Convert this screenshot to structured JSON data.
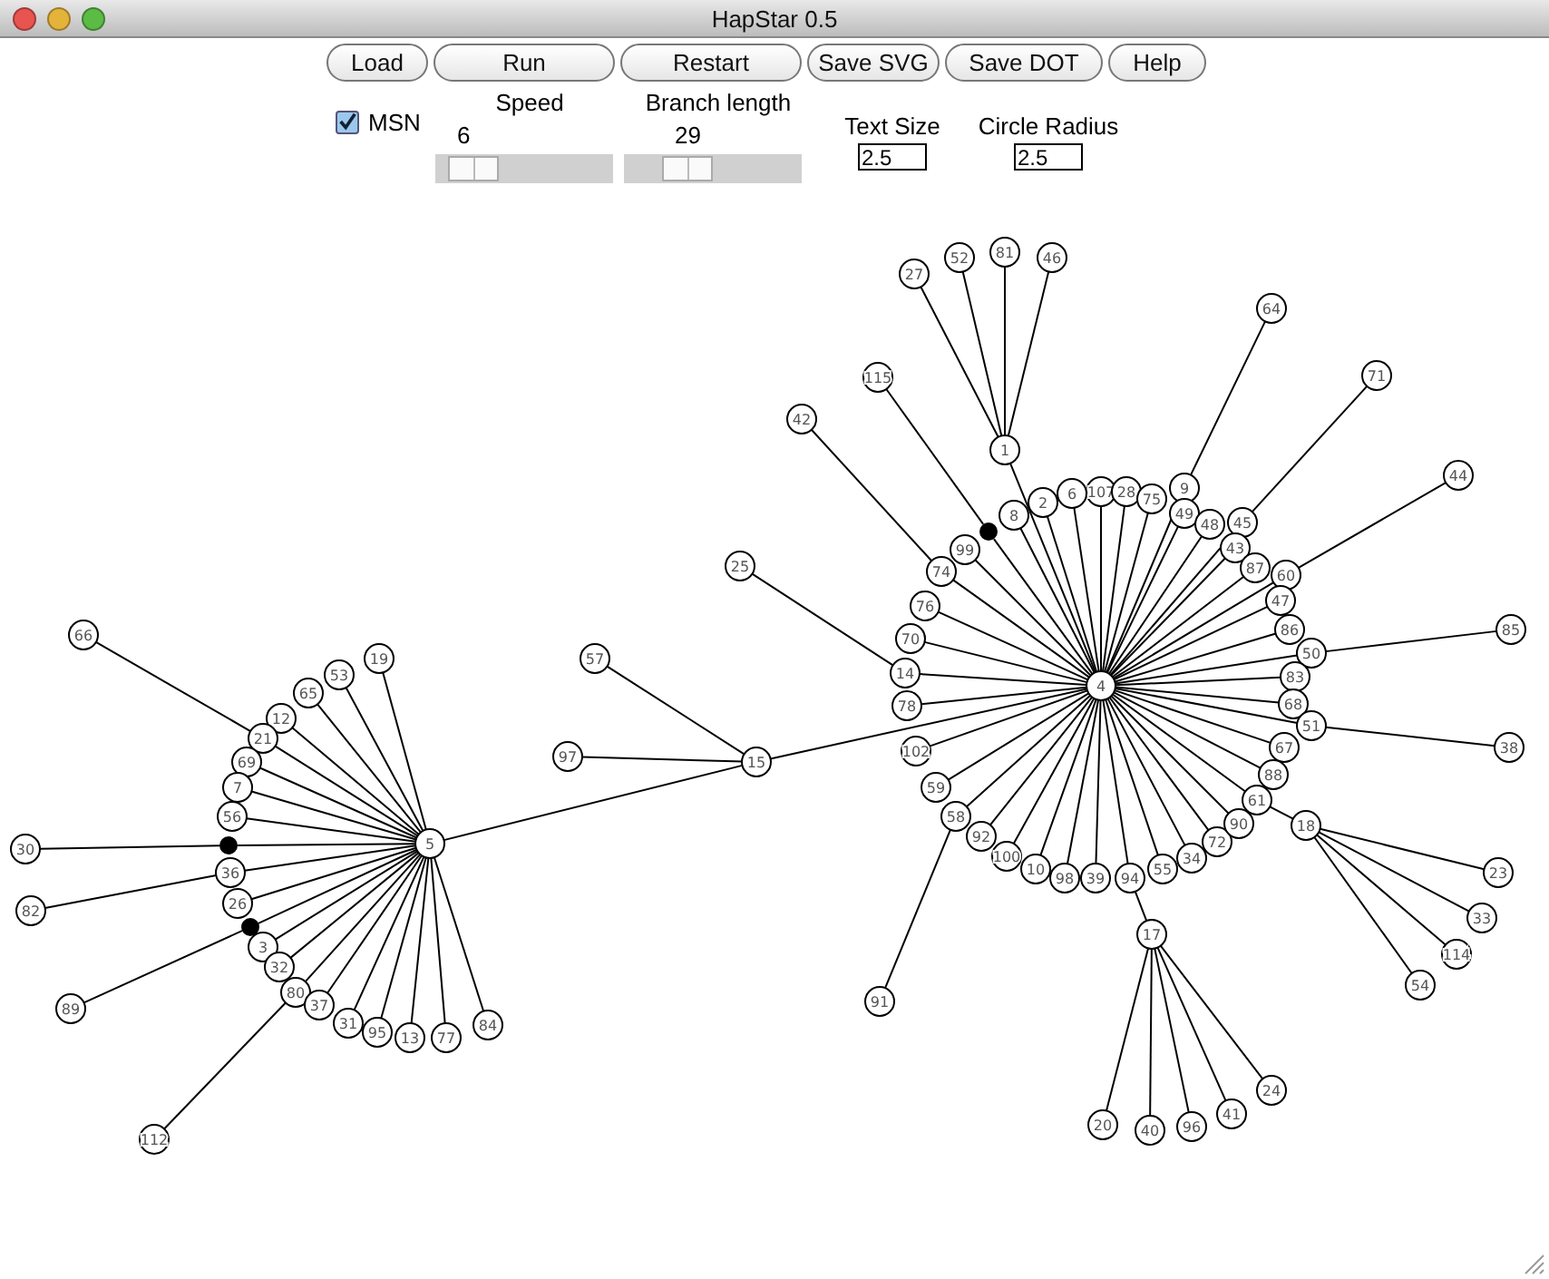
{
  "window": {
    "title": "HapStar 0.5"
  },
  "toolbar": {
    "buttons": [
      "Load",
      "Run",
      "Restart",
      "Save SVG",
      "Save DOT",
      "Help"
    ]
  },
  "controls": {
    "msn": {
      "label": "MSN",
      "checked": true
    },
    "sliders": [
      {
        "label": "Speed",
        "reading": "6",
        "level": 0.1
      },
      {
        "label": "Branch length",
        "reading": "29",
        "level": 0.3
      }
    ],
    "fields": [
      {
        "label": "Text Size",
        "value": "2.5"
      },
      {
        "label": "Circle Radius",
        "value": "2.5"
      }
    ]
  },
  "network": {
    "root": {
      "kind": "haplotype",
      "label": "4",
      "children": [
        {
          "kind": "haplotype",
          "label": "1",
          "children": [
            {
              "kind": "haplotype",
              "label": "27"
            },
            {
              "kind": "haplotype",
              "label": "52"
            },
            {
              "kind": "haplotype",
              "label": "81"
            },
            {
              "kind": "haplotype",
              "label": "46"
            }
          ]
        },
        {
          "kind": "haplotype",
          "label": "8"
        },
        {
          "kind": "haplotype",
          "label": "2"
        },
        {
          "kind": "haplotype",
          "label": "6"
        },
        {
          "kind": "haplotype",
          "label": "107"
        },
        {
          "kind": "haplotype",
          "label": "28"
        },
        {
          "kind": "haplotype",
          "label": "75"
        },
        {
          "kind": "haplotype",
          "label": "9",
          "children": [
            {
              "kind": "haplotype",
              "label": "64"
            }
          ]
        },
        {
          "kind": "haplotype",
          "label": "49"
        },
        {
          "kind": "haplotype",
          "label": "48"
        },
        {
          "kind": "haplotype",
          "label": "45",
          "children": [
            {
              "kind": "haplotype",
              "label": "71"
            }
          ]
        },
        {
          "kind": "haplotype",
          "label": "43"
        },
        {
          "kind": "haplotype",
          "label": "87"
        },
        {
          "kind": "haplotype",
          "label": "60",
          "children": [
            {
              "kind": "haplotype",
              "label": "44"
            }
          ]
        },
        {
          "kind": "haplotype",
          "label": "47"
        },
        {
          "kind": "haplotype",
          "label": "86"
        },
        {
          "kind": "haplotype",
          "label": "50",
          "children": [
            {
              "kind": "haplotype",
              "label": "85"
            }
          ]
        },
        {
          "kind": "haplotype",
          "label": "83"
        },
        {
          "kind": "haplotype",
          "label": "68"
        },
        {
          "kind": "haplotype",
          "label": "67"
        },
        {
          "kind": "haplotype",
          "label": "51",
          "children": [
            {
              "kind": "haplotype",
              "label": "38"
            }
          ]
        },
        {
          "kind": "haplotype",
          "label": "88"
        },
        {
          "kind": "haplotype",
          "label": "61",
          "children": [
            {
              "kind": "haplotype",
              "label": "18",
              "children": [
                {
                  "kind": "haplotype",
                  "label": "23"
                },
                {
                  "kind": "haplotype",
                  "label": "33"
                },
                {
                  "kind": "haplotype",
                  "label": "114"
                },
                {
                  "kind": "haplotype",
                  "label": "54"
                }
              ]
            }
          ]
        },
        {
          "kind": "haplotype",
          "label": "58",
          "children": [
            {
              "kind": "haplotype",
              "label": "91"
            }
          ]
        },
        {
          "kind": "haplotype",
          "label": "92"
        },
        {
          "kind": "haplotype",
          "label": "100"
        },
        {
          "kind": "haplotype",
          "label": "10"
        },
        {
          "kind": "haplotype",
          "label": "98"
        },
        {
          "kind": "haplotype",
          "label": "39"
        },
        {
          "kind": "haplotype",
          "label": "94",
          "children": [
            {
              "kind": "haplotype",
              "label": "17",
              "children": [
                {
                  "kind": "haplotype",
                  "label": "20"
                },
                {
                  "kind": "haplotype",
                  "label": "40"
                },
                {
                  "kind": "haplotype",
                  "label": "96"
                },
                {
                  "kind": "haplotype",
                  "label": "41"
                },
                {
                  "kind": "haplotype",
                  "label": "24"
                }
              ]
            }
          ]
        },
        {
          "kind": "haplotype",
          "label": "55"
        },
        {
          "kind": "haplotype",
          "label": "34"
        },
        {
          "kind": "haplotype",
          "label": "72"
        },
        {
          "kind": "haplotype",
          "label": "90"
        },
        {
          "kind": "median",
          "children": [
            {
              "kind": "haplotype",
              "label": "115"
            }
          ]
        },
        {
          "kind": "haplotype",
          "label": "99"
        },
        {
          "kind": "haplotype",
          "label": "74",
          "children": [
            {
              "kind": "haplotype",
              "label": "42"
            }
          ]
        },
        {
          "kind": "haplotype",
          "label": "76"
        },
        {
          "kind": "haplotype",
          "label": "70"
        },
        {
          "kind": "haplotype",
          "label": "14",
          "children": [
            {
              "kind": "haplotype",
              "label": "25"
            }
          ]
        },
        {
          "kind": "haplotype",
          "label": "78"
        },
        {
          "kind": "haplotype",
          "label": "102"
        },
        {
          "kind": "haplotype",
          "label": "59"
        },
        {
          "kind": "haplotype",
          "label": "15",
          "children": [
            {
              "kind": "haplotype",
              "label": "57"
            },
            {
              "kind": "haplotype",
              "label": "97"
            },
            {
              "kind": "haplotype",
              "label": "5",
              "children": [
                {
                  "kind": "haplotype",
                  "label": "19"
                },
                {
                  "kind": "haplotype",
                  "label": "53"
                },
                {
                  "kind": "haplotype",
                  "label": "65"
                },
                {
                  "kind": "haplotype",
                  "label": "12"
                },
                {
                  "kind": "haplotype",
                  "label": "21",
                  "children": [
                    {
                      "kind": "haplotype",
                      "label": "66"
                    }
                  ]
                },
                {
                  "kind": "haplotype",
                  "label": "69"
                },
                {
                  "kind": "haplotype",
                  "label": "7"
                },
                {
                  "kind": "haplotype",
                  "label": "56"
                },
                {
                  "kind": "median",
                  "children": [
                    {
                      "kind": "haplotype",
                      "label": "30"
                    }
                  ]
                },
                {
                  "kind": "haplotype",
                  "label": "36",
                  "children": [
                    {
                      "kind": "haplotype",
                      "label": "82"
                    }
                  ]
                },
                {
                  "kind": "haplotype",
                  "label": "26"
                },
                {
                  "kind": "median",
                  "children": [
                    {
                      "kind": "haplotype",
                      "label": "89"
                    }
                  ]
                },
                {
                  "kind": "haplotype",
                  "label": "3"
                },
                {
                  "kind": "haplotype",
                  "label": "32"
                },
                {
                  "kind": "haplotype",
                  "label": "80",
                  "children": [
                    {
                      "kind": "haplotype",
                      "label": "112"
                    }
                  ]
                },
                {
                  "kind": "haplotype",
                  "label": "37"
                },
                {
                  "kind": "haplotype",
                  "label": "31"
                },
                {
                  "kind": "haplotype",
                  "label": "95"
                },
                {
                  "kind": "haplotype",
                  "label": "13"
                },
                {
                  "kind": "haplotype",
                  "label": "77"
                },
                {
                  "kind": "haplotype",
                  "label": "84"
                }
              ]
            }
          ]
        }
      ]
    }
  }
}
